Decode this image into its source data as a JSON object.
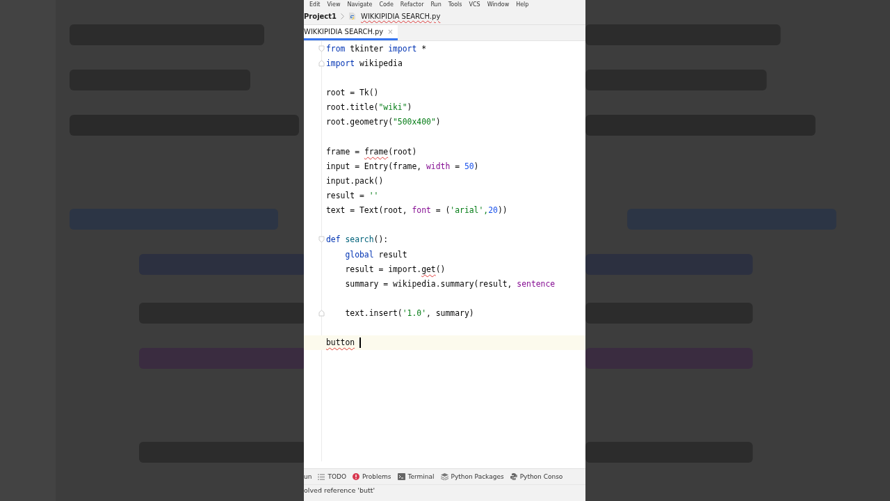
{
  "menu": [
    "Edit",
    "View",
    "Navigate",
    "Code",
    "Refactor",
    "Run",
    "Tools",
    "VCS",
    "Window",
    "Help"
  ],
  "breadcrumb": {
    "project": "Project1",
    "file": "WIKKIPIDIA SEARCH.py"
  },
  "tabs": [
    {
      "label": "WIKKIPIDIA SEARCH.py",
      "close": "×",
      "selected": true
    }
  ],
  "editor": {
    "lines": [
      {
        "kind": "code",
        "current": false,
        "fold": {
          "kind": "start"
        },
        "tokens": [
          {
            "text": "from",
            "kind": "keyword"
          },
          {
            "text": " tkinter ",
            "kind": "plain"
          },
          {
            "text": "import",
            "kind": "keyword"
          },
          {
            "text": " *",
            "kind": "plain"
          }
        ]
      },
      {
        "kind": "code",
        "current": false,
        "fold": {
          "kind": "end"
        },
        "tokens": [
          {
            "text": "import",
            "kind": "keyword"
          },
          {
            "text": " wikipedia",
            "kind": "plain"
          }
        ]
      },
      {
        "kind": "blank",
        "current": false
      },
      {
        "kind": "code",
        "current": false,
        "tokens": [
          {
            "text": "root = Tk()",
            "kind": "plain"
          }
        ]
      },
      {
        "kind": "code",
        "current": false,
        "tokens": [
          {
            "text": "root.title(",
            "kind": "plain"
          },
          {
            "text": "\"wiki\"",
            "kind": "string"
          },
          {
            "text": ")",
            "kind": "plain"
          }
        ]
      },
      {
        "kind": "code",
        "current": false,
        "tokens": [
          {
            "text": "root.geometry(",
            "kind": "plain"
          },
          {
            "text": "\"500x400\"",
            "kind": "string"
          },
          {
            "text": ")",
            "kind": "plain"
          }
        ]
      },
      {
        "kind": "blank",
        "current": false
      },
      {
        "kind": "code",
        "current": false,
        "tokens": [
          {
            "text": "frame = ",
            "kind": "plain"
          },
          {
            "text": "frame",
            "kind": "error"
          },
          {
            "text": "(root)",
            "kind": "plain"
          }
        ]
      },
      {
        "kind": "code",
        "current": false,
        "tokens": [
          {
            "text": "input = Entry(frame, ",
            "kind": "plain"
          },
          {
            "text": "width",
            "kind": "param"
          },
          {
            "text": " = ",
            "kind": "plain"
          },
          {
            "text": "50",
            "kind": "number"
          },
          {
            "text": ")",
            "kind": "plain"
          }
        ]
      },
      {
        "kind": "code",
        "current": false,
        "tokens": [
          {
            "text": "input.pack()",
            "kind": "plain"
          }
        ]
      },
      {
        "kind": "code",
        "current": false,
        "tokens": [
          {
            "text": "result = ",
            "kind": "plain"
          },
          {
            "text": "''",
            "kind": "string"
          }
        ]
      },
      {
        "kind": "code",
        "current": false,
        "tokens": [
          {
            "text": "text = Text(root, ",
            "kind": "plain"
          },
          {
            "text": "font",
            "kind": "param"
          },
          {
            "text": " = (",
            "kind": "plain"
          },
          {
            "text": "'arial',",
            "kind": "string"
          },
          {
            "text": "20",
            "kind": "number"
          },
          {
            "text": "))",
            "kind": "plain"
          }
        ]
      },
      {
        "kind": "blank",
        "current": false
      },
      {
        "kind": "code",
        "current": false,
        "fold": {
          "kind": "start"
        },
        "tokens": [
          {
            "text": "def",
            "kind": "keyword"
          },
          {
            "text": " search",
            "kind": "function"
          },
          {
            "text": "():",
            "kind": "plain"
          }
        ]
      },
      {
        "kind": "code",
        "current": false,
        "tokens": [
          {
            "text": "    global",
            "kind": "keyword"
          },
          {
            "text": " result",
            "kind": "plain"
          }
        ]
      },
      {
        "kind": "code",
        "current": false,
        "tokens": [
          {
            "text": "    result = import.",
            "kind": "plain"
          },
          {
            "text": "get",
            "kind": "error"
          },
          {
            "text": "()",
            "kind": "plain"
          }
        ]
      },
      {
        "kind": "code",
        "current": false,
        "tokens": [
          {
            "text": "    summary = wikipedia.summary(result, ",
            "kind": "plain"
          },
          {
            "text": "sentence",
            "kind": "param"
          }
        ]
      },
      {
        "kind": "blank",
        "current": false
      },
      {
        "kind": "code",
        "current": false,
        "fold": {
          "kind": "end"
        },
        "tokens": [
          {
            "text": "    text.insert(",
            "kind": "plain"
          },
          {
            "text": "'1.0'",
            "kind": "string"
          },
          {
            "text": ", summary)",
            "kind": "plain"
          }
        ]
      },
      {
        "kind": "blank",
        "current": false
      },
      {
        "kind": "code",
        "current": true,
        "tokens": [
          {
            "text": "button",
            "kind": "error"
          }
        ]
      }
    ]
  },
  "tool_windows": [
    {
      "label": "un",
      "kind": "run"
    },
    {
      "label": "TODO",
      "kind": "todo"
    },
    {
      "label": "Problems",
      "kind": "problems"
    },
    {
      "label": "Terminal",
      "kind": "terminal"
    },
    {
      "label": "Python Packages",
      "kind": "packages"
    },
    {
      "label": "Python Conso",
      "kind": "console"
    }
  ],
  "status_bar": {
    "message": "olved reference 'butt'"
  }
}
